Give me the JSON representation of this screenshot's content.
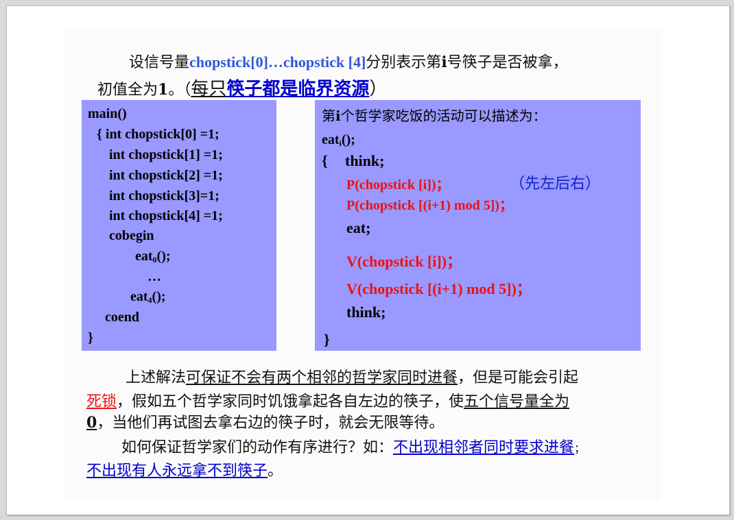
{
  "intro": {
    "line1_prefix": "设信号量",
    "line1_var": "chopstick[0]…chopstick [4]",
    "line1_mid": "分别表示第",
    "line1_i": "i",
    "line1_suffix": "号筷子是否被拿，",
    "line2_prefix": "初值全为",
    "line2_one": "1",
    "line2_dot": "。（",
    "line2_each": "每只",
    "line2_resource": "筷子都是临界资源",
    "line2_close": "）"
  },
  "left_code": {
    "lines": [
      "main()",
      "{ int chopstick[0] =1;",
      "int chopstick[1] =1;",
      "int chopstick[2] =1;",
      "int chopstick[3]=1;",
      "int chopstick[4] =1;",
      "cobegin",
      "eat",
      "…",
      "eat",
      "coend",
      "}"
    ],
    "eat0_sub": "0",
    "eat0_tail": "();",
    "eat4_sub": "4",
    "eat4_tail": "();"
  },
  "right_code": {
    "heading_prefix": "第",
    "heading_i": "i",
    "heading_suffix": "个哲学家吃饭的活动可以描述为：",
    "eat_name": "eat",
    "eat_sub": "i",
    "eat_tail": "();",
    "open": "{",
    "think1": "think;",
    "p1": "P(chopstick [i])；",
    "note": "（先左后右）",
    "p2": "P(chopstick [(i+1) mod 5])；",
    "eat": "eat;",
    "v1": "V(chopstick [i])；",
    "v2": "V(chopstick [(i+1) mod 5])；",
    "think2": "think;",
    "close": "}"
  },
  "para1": {
    "a": "上述解法",
    "b": "可保证不会有两个相邻的哲学家同时进餐",
    "c": "，但是可能会引起",
    "deadlock": "死锁",
    "d": "，假如五个哲学家同时饥饿拿起各自左边的筷子，使",
    "e": "五个信号量全为",
    "zero": "0",
    "f": "，当他们再试图去拿右边的筷子时，就会无限等待。"
  },
  "para2": {
    "a": "如何保证哲学家们的动作有序进行？如：",
    "b": "不出现相邻者同时要求进餐",
    "c": "；",
    "d": "不出现有人永远拿不到筷子",
    "e": "。"
  },
  "colors": {
    "box_bg": "#9999ff",
    "blue_text": "#3355dd",
    "red_text": "#ee1111",
    "link_blue": "#0000cc"
  }
}
